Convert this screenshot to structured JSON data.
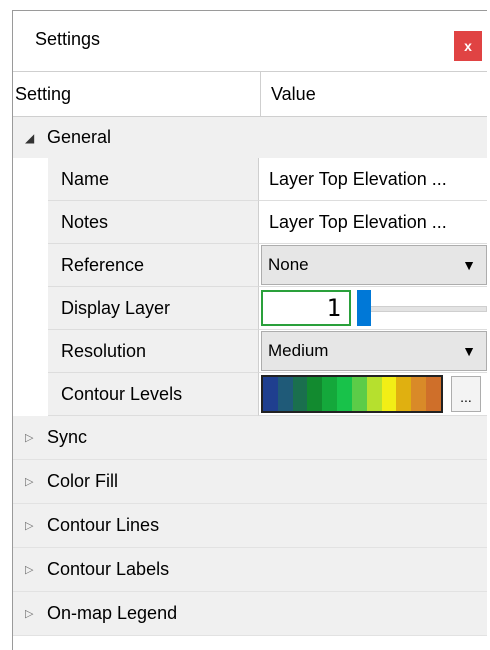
{
  "panel": {
    "title": "Settings",
    "close_label": "x"
  },
  "columns": {
    "setting": "Setting",
    "value": "Value"
  },
  "general": {
    "label": "General",
    "rows": {
      "name": {
        "label": "Name",
        "value": "Layer Top Elevation ..."
      },
      "notes": {
        "label": "Notes",
        "value": "Layer Top Elevation ..."
      },
      "reference": {
        "label": "Reference",
        "value": "None"
      },
      "display_layer": {
        "label": "Display Layer",
        "value": "1",
        "slider_fraction": 0.0
      },
      "resolution": {
        "label": "Resolution",
        "value": "Medium"
      },
      "contour_levels": {
        "label": "Contour Levels",
        "button_label": "...",
        "colors": [
          "#1f3f8f",
          "#1f5a78",
          "#1a6f4e",
          "#128a2f",
          "#14a83b",
          "#18c24a",
          "#5ccc48",
          "#b6e02e",
          "#f2ee16",
          "#e0b010",
          "#d98a28",
          "#cf6f2a"
        ]
      }
    }
  },
  "groups": [
    {
      "label": "Sync"
    },
    {
      "label": "Color Fill"
    },
    {
      "label": "Contour Lines"
    },
    {
      "label": "Contour Labels"
    },
    {
      "label": "On-map Legend"
    }
  ],
  "icons": {
    "expanded": "triangle-down-icon",
    "collapsed": "triangle-right-icon"
  }
}
